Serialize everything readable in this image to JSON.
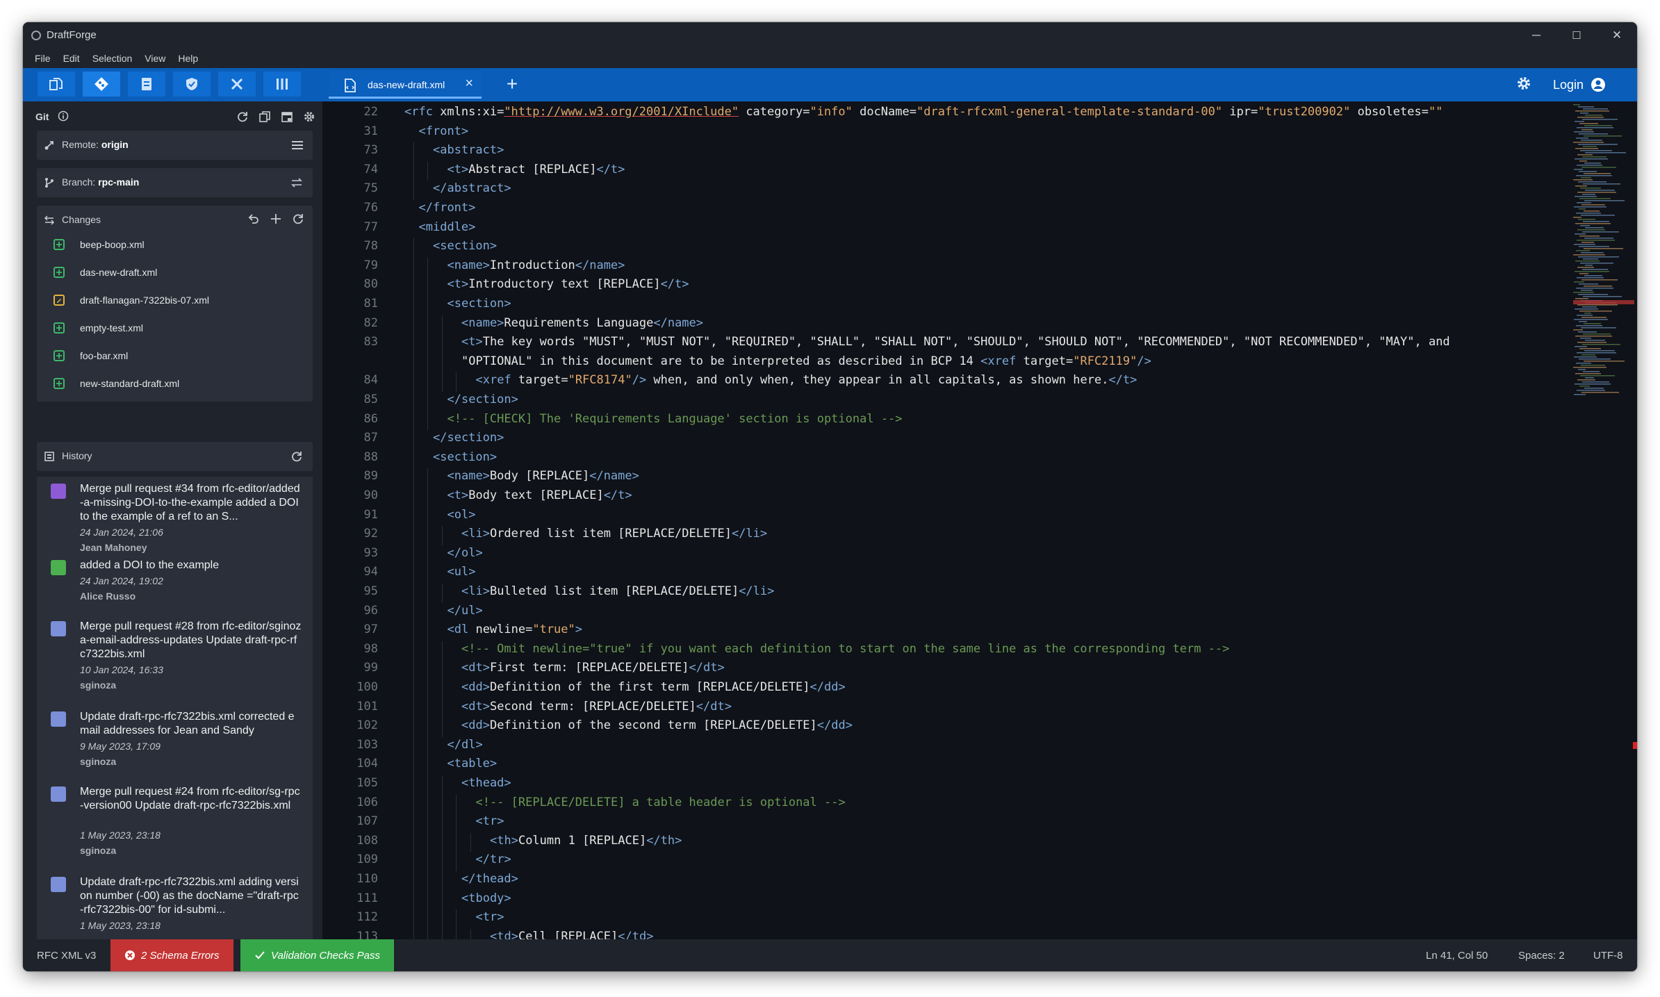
{
  "window": {
    "title": "DraftForge",
    "controls": [
      "─",
      "☐",
      "✕"
    ]
  },
  "menu": [
    "File",
    "Edit",
    "Selection",
    "View",
    "Help"
  ],
  "toolbar": {
    "tab": {
      "label": "das-new-draft.xml",
      "close": "×"
    },
    "new_tab": "+",
    "login_label": "Login"
  },
  "sidebar": {
    "git_label": "Git",
    "remote": {
      "label": "Remote:",
      "value": "origin"
    },
    "branch": {
      "label": "Branch:",
      "value": "rpc-main"
    },
    "changes_label": "Changes",
    "changes": [
      {
        "name": "beep-boop.xml",
        "status": "added"
      },
      {
        "name": "das-new-draft.xml",
        "status": "added"
      },
      {
        "name": "draft-flanagan-7322bis-07.xml",
        "status": "modified"
      },
      {
        "name": "empty-test.xml",
        "status": "added"
      },
      {
        "name": "foo-bar.xml",
        "status": "added"
      },
      {
        "name": "new-standard-draft.xml",
        "status": "added"
      }
    ],
    "history_label": "History",
    "history": [
      {
        "message": "Merge pull request #34 from rfc-editor/added-a-missing-DOI-to-the-example added a DOI to the example of a ref to an S...",
        "date": "24 Jan 2024, 21:06",
        "author": "Jean Mahoney",
        "avatar_color": "#8e5bd6"
      },
      {
        "message": "added a DOI to the example",
        "date": "24 Jan 2024, 19:02",
        "author": "Alice Russo",
        "avatar_color": "#4caf50"
      },
      {
        "message": "Merge pull request #28 from rfc-editor/sginoza-email-address-updates Update draft-rpc-rfc7322bis.xml",
        "date": "10 Jan 2024, 16:33",
        "author": "sginoza",
        "avatar_color": "#7c8fd9"
      },
      {
        "message": "Update draft-rpc-rfc7322bis.xml corrected email addresses for Jean and Sandy",
        "date": "9 May 2023, 17:09",
        "author": "sginoza",
        "avatar_color": "#7c8fd9"
      },
      {
        "message": "Merge pull request #24 from rfc-editor/sg-rpc-version00 Update draft-rpc-rfc7322bis.xml",
        "date": "1 May 2023, 23:18",
        "author": "sginoza",
        "avatar_color": "#7c8fd9"
      },
      {
        "message": "Update draft-rpc-rfc7322bis.xml adding version number (-00) as the docName =\"draft-rpc-rfc7322bis-00\" for id-submi...",
        "date": "1 May 2023, 23:18",
        "author": "",
        "avatar_color": "#7c8fd9"
      }
    ]
  },
  "editor": {
    "lines": [
      {
        "n": "22",
        "indent": 0,
        "seg": [
          [
            "tag",
            "<rfc "
          ],
          [
            "attr",
            "xmlns:xi="
          ],
          [
            "url",
            "\"http://www.w3.org/2001/XInclude\""
          ],
          [
            "attr",
            " category="
          ],
          [
            "str",
            "\"info\""
          ],
          [
            "attr",
            " docName="
          ],
          [
            "str",
            "\"draft-rfcxml-general-template-standard-00\""
          ],
          [
            "attr",
            " ipr="
          ],
          [
            "str",
            "\"trust200902\""
          ],
          [
            "attr",
            " obsoletes="
          ],
          [
            "str",
            "\"\""
          ]
        ]
      },
      {
        "n": "31",
        "indent": 1,
        "seg": [
          [
            "tag",
            "<front>"
          ]
        ]
      },
      {
        "n": "73",
        "indent": 2,
        "seg": [
          [
            "tag",
            "<abstract>"
          ]
        ]
      },
      {
        "n": "74",
        "indent": 3,
        "seg": [
          [
            "tag",
            "<t>"
          ],
          [
            "attr",
            "Abstract [REPLACE]"
          ],
          [
            "tag",
            "</t>"
          ]
        ]
      },
      {
        "n": "75",
        "indent": 2,
        "seg": [
          [
            "tag",
            "</abstract>"
          ]
        ]
      },
      {
        "n": "76",
        "indent": 1,
        "seg": [
          [
            "tag",
            "</front>"
          ]
        ]
      },
      {
        "n": "77",
        "indent": 1,
        "seg": [
          [
            "tag",
            "<middle>"
          ]
        ]
      },
      {
        "n": "78",
        "indent": 2,
        "seg": [
          [
            "tag",
            "<section>"
          ]
        ]
      },
      {
        "n": "79",
        "indent": 3,
        "seg": [
          [
            "tag",
            "<name>"
          ],
          [
            "attr",
            "Introduction"
          ],
          [
            "tag",
            "</name>"
          ]
        ]
      },
      {
        "n": "80",
        "indent": 3,
        "seg": [
          [
            "tag",
            "<t>"
          ],
          [
            "attr",
            "Introductory text [REPLACE]"
          ],
          [
            "tag",
            "</t>"
          ]
        ]
      },
      {
        "n": "81",
        "indent": 3,
        "seg": [
          [
            "tag",
            "<section>"
          ]
        ]
      },
      {
        "n": "82",
        "indent": 4,
        "seg": [
          [
            "tag",
            "<name>"
          ],
          [
            "attr",
            "Requirements Language"
          ],
          [
            "tag",
            "</name>"
          ]
        ]
      },
      {
        "n": "83",
        "indent": 4,
        "seg": [
          [
            "tag",
            "<t>"
          ],
          [
            "attr",
            "The key words \"MUST\", \"MUST NOT\", \"REQUIRED\", \"SHALL\", \"SHALL NOT\", \"SHOULD\", \"SHOULD NOT\", \"RECOMMENDED\", \"NOT RECOMMENDED\", \"MAY\", and"
          ]
        ]
      },
      {
        "n": "",
        "indent": 4,
        "seg": [
          [
            "attr",
            "\"OPTIONAL\" in this document are to be interpreted as described in BCP 14 "
          ],
          [
            "tag",
            "<xref "
          ],
          [
            "attr",
            "target="
          ],
          [
            "str",
            "\"RFC2119\""
          ],
          [
            "tag",
            "/>"
          ]
        ]
      },
      {
        "n": "84",
        "indent": 5,
        "seg": [
          [
            "tag",
            "<xref "
          ],
          [
            "attr",
            "target="
          ],
          [
            "str",
            "\"RFC8174\""
          ],
          [
            "tag",
            "/>"
          ],
          [
            "attr",
            " when, and only when, they appear in all capitals, as shown here."
          ],
          [
            "tag",
            "</t>"
          ]
        ]
      },
      {
        "n": "85",
        "indent": 3,
        "seg": [
          [
            "tag",
            "</section>"
          ]
        ]
      },
      {
        "n": "86",
        "indent": 3,
        "seg": [
          [
            "cmt",
            "<!-- [CHECK] The 'Requirements Language' section is optional -->"
          ]
        ]
      },
      {
        "n": "87",
        "indent": 2,
        "seg": [
          [
            "tag",
            "</section>"
          ]
        ]
      },
      {
        "n": "88",
        "indent": 2,
        "seg": [
          [
            "tag",
            "<section>"
          ]
        ]
      },
      {
        "n": "89",
        "indent": 3,
        "seg": [
          [
            "tag",
            "<name>"
          ],
          [
            "attr",
            "Body [REPLACE]"
          ],
          [
            "tag",
            "</name>"
          ]
        ]
      },
      {
        "n": "90",
        "indent": 3,
        "seg": [
          [
            "tag",
            "<t>"
          ],
          [
            "attr",
            "Body text [REPLACE]"
          ],
          [
            "tag",
            "</t>"
          ]
        ]
      },
      {
        "n": "91",
        "indent": 3,
        "seg": [
          [
            "tag",
            "<ol>"
          ]
        ]
      },
      {
        "n": "92",
        "indent": 4,
        "seg": [
          [
            "tag",
            "<li>"
          ],
          [
            "attr",
            "Ordered list item [REPLACE/DELETE]"
          ],
          [
            "tag",
            "</li>"
          ]
        ]
      },
      {
        "n": "93",
        "indent": 3,
        "seg": [
          [
            "tag",
            "</ol>"
          ]
        ]
      },
      {
        "n": "94",
        "indent": 3,
        "seg": [
          [
            "tag",
            "<ul>"
          ]
        ]
      },
      {
        "n": "95",
        "indent": 4,
        "seg": [
          [
            "tag",
            "<li>"
          ],
          [
            "attr",
            "Bulleted list item [REPLACE/DELETE]"
          ],
          [
            "tag",
            "</li>"
          ]
        ]
      },
      {
        "n": "96",
        "indent": 3,
        "seg": [
          [
            "tag",
            "</ul>"
          ]
        ]
      },
      {
        "n": "97",
        "indent": 3,
        "seg": [
          [
            "tag",
            "<dl "
          ],
          [
            "attr",
            "newline="
          ],
          [
            "str",
            "\"true\""
          ],
          [
            "tag",
            ">"
          ]
        ]
      },
      {
        "n": "98",
        "indent": 4,
        "seg": [
          [
            "cmt",
            "<!-- Omit newline=\"true\" if you want each definition to start on the same line as the corresponding term -->"
          ]
        ]
      },
      {
        "n": "99",
        "indent": 4,
        "seg": [
          [
            "tag",
            "<dt>"
          ],
          [
            "attr",
            "First term: [REPLACE/DELETE]"
          ],
          [
            "tag",
            "</dt>"
          ]
        ]
      },
      {
        "n": "100",
        "indent": 4,
        "seg": [
          [
            "tag",
            "<dd>"
          ],
          [
            "attr",
            "Definition of the first term [REPLACE/DELETE]"
          ],
          [
            "tag",
            "</dd>"
          ]
        ]
      },
      {
        "n": "101",
        "indent": 4,
        "seg": [
          [
            "tag",
            "<dt>"
          ],
          [
            "attr",
            "Second term: [REPLACE/DELETE]"
          ],
          [
            "tag",
            "</dt>"
          ]
        ]
      },
      {
        "n": "102",
        "indent": 4,
        "seg": [
          [
            "tag",
            "<dd>"
          ],
          [
            "attr",
            "Definition of the second term [REPLACE/DELETE]"
          ],
          [
            "tag",
            "</dd>"
          ]
        ]
      },
      {
        "n": "103",
        "indent": 3,
        "seg": [
          [
            "tag",
            "</dl>"
          ]
        ]
      },
      {
        "n": "104",
        "indent": 3,
        "seg": [
          [
            "tag",
            "<table>"
          ]
        ]
      },
      {
        "n": "105",
        "indent": 4,
        "seg": [
          [
            "tag",
            "<thead>"
          ]
        ]
      },
      {
        "n": "106",
        "indent": 5,
        "seg": [
          [
            "cmt",
            "<!-- [REPLACE/DELETE] a table header is optional -->"
          ]
        ]
      },
      {
        "n": "107",
        "indent": 5,
        "seg": [
          [
            "tag",
            "<tr>"
          ]
        ]
      },
      {
        "n": "108",
        "indent": 6,
        "seg": [
          [
            "tag",
            "<th>"
          ],
          [
            "attr",
            "Column 1 [REPLACE]"
          ],
          [
            "tag",
            "</th>"
          ]
        ]
      },
      {
        "n": "109",
        "indent": 5,
        "seg": [
          [
            "tag",
            "</tr>"
          ]
        ]
      },
      {
        "n": "110",
        "indent": 4,
        "seg": [
          [
            "tag",
            "</thead>"
          ]
        ]
      },
      {
        "n": "111",
        "indent": 4,
        "seg": [
          [
            "tag",
            "<tbody>"
          ]
        ]
      },
      {
        "n": "112",
        "indent": 5,
        "seg": [
          [
            "tag",
            "<tr>"
          ]
        ]
      },
      {
        "n": "113",
        "indent": 6,
        "seg": [
          [
            "tag",
            "<td>"
          ],
          [
            "attr",
            "Cell [REPLACE]"
          ],
          [
            "tag",
            "</td>"
          ]
        ]
      }
    ]
  },
  "status": {
    "language": "RFC XML v3",
    "errors": "2 Schema Errors",
    "validation": "Validation Checks Pass",
    "position": "Ln 41, Col 50",
    "spaces": "Spaces: 2",
    "encoding": "UTF-8"
  },
  "colors": {
    "accent": "#0a5db8",
    "error": "#c43434",
    "success": "#37a84a",
    "tag": "#7ea9d8",
    "string": "#e1a86c",
    "comment": "#6a9955"
  }
}
